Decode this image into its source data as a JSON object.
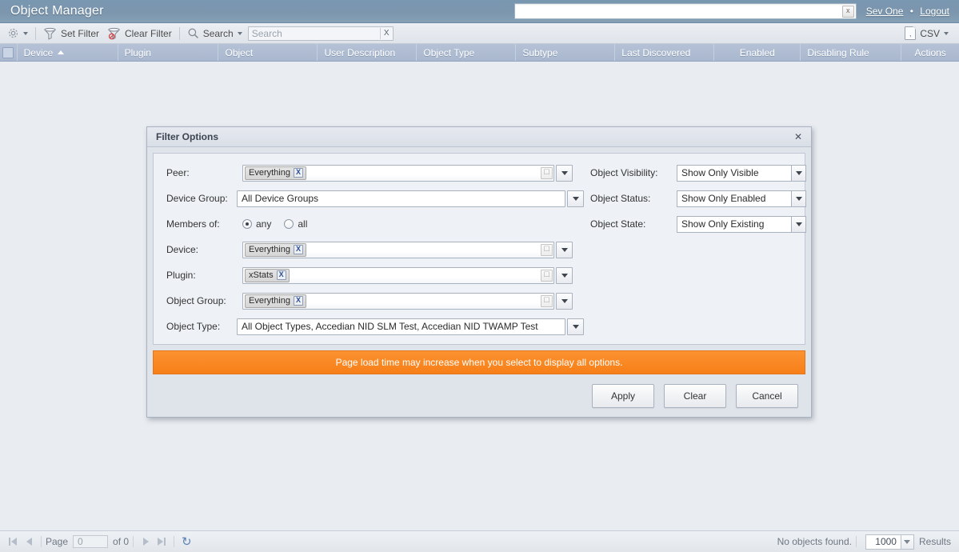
{
  "header": {
    "title": "Object Manager",
    "global_search_value": "",
    "clear_icon": "x",
    "user_name": "Sev One",
    "separator": "•",
    "logout_label": "Logout"
  },
  "toolbar": {
    "gear_label": "",
    "set_filter_label": "Set Filter",
    "clear_filter_label": "Clear Filter",
    "search_label": "Search",
    "search_placeholder": "Search",
    "search_value": "",
    "search_clear_icon": "X",
    "csv_label": "CSV"
  },
  "table": {
    "columns": [
      {
        "label": "Device",
        "sorted": "asc"
      },
      {
        "label": "Plugin",
        "sorted": ""
      },
      {
        "label": "Object",
        "sorted": ""
      },
      {
        "label": "User Description",
        "sorted": ""
      },
      {
        "label": "Object Type",
        "sorted": ""
      },
      {
        "label": "Subtype",
        "sorted": ""
      },
      {
        "label": "Last Discovered",
        "sorted": ""
      },
      {
        "label": "Enabled",
        "sorted": ""
      },
      {
        "label": "Disabling Rule",
        "sorted": ""
      },
      {
        "label": "Actions",
        "sorted": ""
      }
    ]
  },
  "dialog": {
    "title": "Filter Options",
    "close_icon": "✕",
    "peer": {
      "label": "Peer:",
      "chip": "Everything",
      "chip_remove": "X"
    },
    "device_group": {
      "label": "Device Group:",
      "value": "All Device Groups"
    },
    "members_of": {
      "label": "Members of:",
      "options": [
        {
          "label": "any",
          "selected": true
        },
        {
          "label": "all",
          "selected": false
        }
      ]
    },
    "device": {
      "label": "Device:",
      "chip": "Everything",
      "chip_remove": "X",
      "clear_icon": "⌧"
    },
    "plugin": {
      "label": "Plugin:",
      "chip": "xStats",
      "chip_remove": "X",
      "clear_icon": "⌧"
    },
    "object_group": {
      "label": "Object Group:",
      "chip": "Everything",
      "chip_remove": "X",
      "clear_icon": "⌧"
    },
    "object_type": {
      "label": "Object Type:",
      "value": "All Object Types, Accedian NID SLM Test, Accedian NID TWAMP Test"
    },
    "object_visibility": {
      "label": "Object Visibility:",
      "value": "Show Only Visible"
    },
    "object_status": {
      "label": "Object Status:",
      "value": "Show Only Enabled"
    },
    "object_state": {
      "label": "Object State:",
      "value": "Show Only Existing"
    },
    "warning": "Page load time may increase when you select to display all options.",
    "buttons": {
      "apply": "Apply",
      "clear": "Clear",
      "cancel": "Cancel"
    }
  },
  "footer": {
    "page_label": "Page",
    "page_value": "0",
    "of_label": "of 0",
    "refresh_icon": "↻",
    "status": "No objects found.",
    "results_value": "1000",
    "results_label": "Results"
  },
  "colors": {
    "header_blue": "#7b96ad",
    "table_head": "#aab8cf",
    "warning_orange": "#f77f18",
    "body_bg": "#e9ecf1"
  }
}
